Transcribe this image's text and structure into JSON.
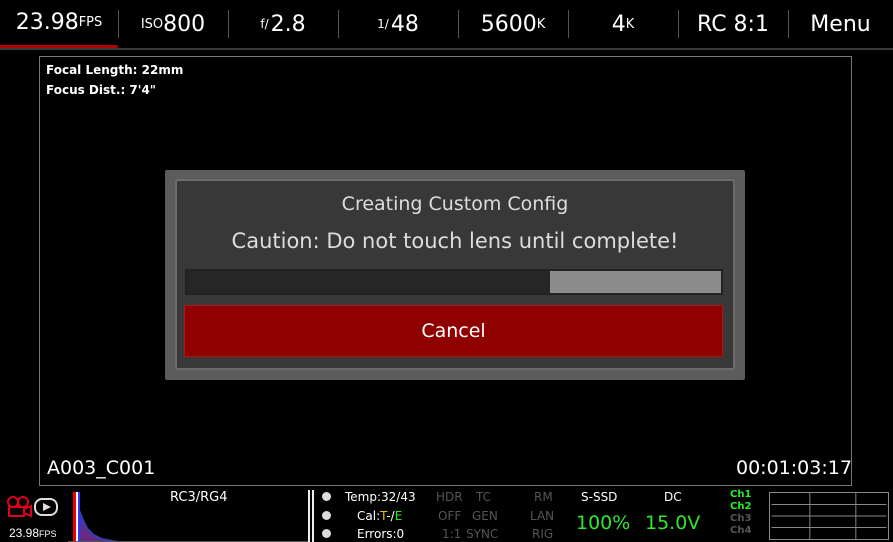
{
  "topbar": {
    "fps": "23.98",
    "fps_unit": "FPS",
    "iso_prefix": "ISO",
    "iso_value": "800",
    "aperture_prefix": "f/",
    "aperture_value": "2.8",
    "shutter_prefix": "1/",
    "shutter_value": "48",
    "white_balance": "5600",
    "white_balance_unit": "K",
    "resolution": "4",
    "resolution_unit": "K",
    "compression": "RC 8:1",
    "menu": "Menu"
  },
  "lens_info": {
    "focal_length": "Focal Length: 22mm",
    "focus_distance": "Focus Dist.: 7'4\""
  },
  "clip_name": "A003_C001",
  "timecode": "00:01:03:17",
  "dialog": {
    "title": "Creating Custom Config",
    "message": "Caution: Do not touch lens until complete!",
    "progress": 0.68,
    "cancel_label": "Cancel"
  },
  "bottom": {
    "fps": "23.98",
    "fps_unit": "FPS",
    "histogram_label": "RC3/RG4",
    "temp": "Temp:32/43",
    "cal_prefix": "Cal:",
    "cal_t": "T",
    "cal_sep": "-/",
    "cal_e": "E",
    "errors": "Errors:0",
    "hdr": "HDR",
    "hdr_value": "OFF",
    "ratio": "1:1",
    "tc": "TC",
    "tc_gen": "GEN",
    "tc_sync": "SYNC",
    "rm": "RM",
    "rm_lan": "LAN",
    "rm_rig": "RIG",
    "media": "S-SSD",
    "media_value": "100%",
    "power": "DC",
    "power_value": "15.0V",
    "channels": [
      "Ch1",
      "Ch2",
      "Ch3",
      "Ch4"
    ],
    "colors": {
      "active": "#2ee82e",
      "inactive": "#555555",
      "record": "#e0001a",
      "accent": "#b00000"
    }
  }
}
